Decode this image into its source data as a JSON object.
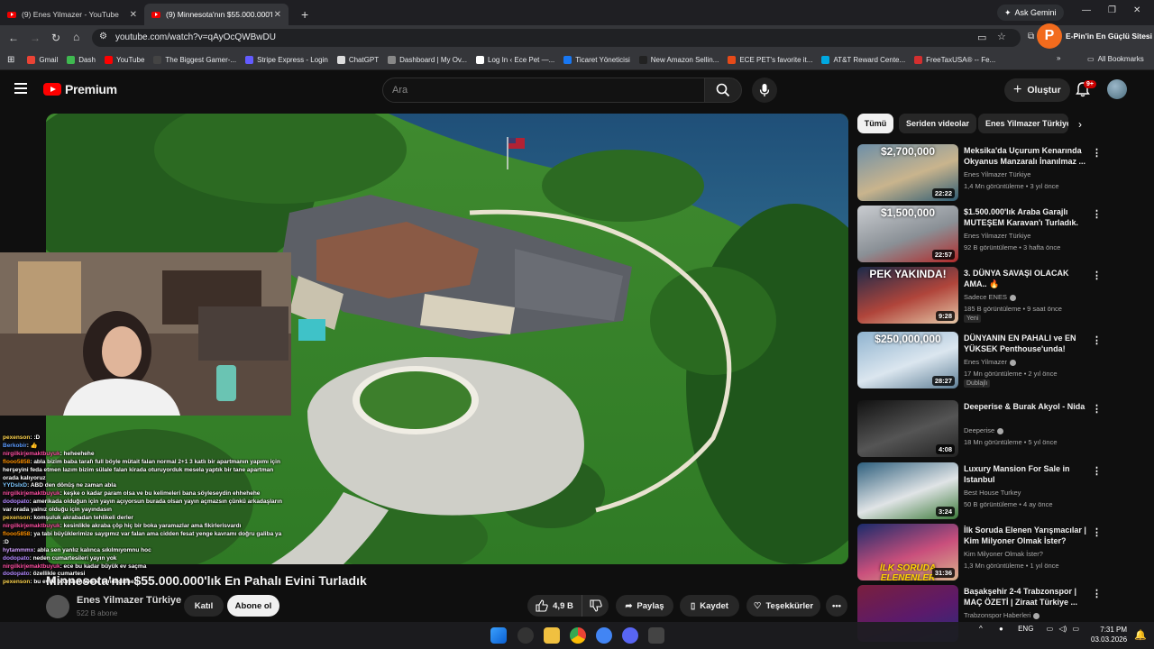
{
  "browser": {
    "tabs": [
      {
        "label": "(9) Enes Yilmazer - YouTube",
        "active": false
      },
      {
        "label": "(9) Minnesota'nın $55.000.000'l",
        "active": true
      }
    ],
    "ask_gemini": "Ask Gemini",
    "url": "youtube.com/watch?v=qAyOcQWBwDU",
    "extension_label": "E-Pin'in En Güçlü Sitesi",
    "extension_letter": "P",
    "bookmarks": [
      {
        "label": "Gmail",
        "color": "#ea4335"
      },
      {
        "label": "Dash",
        "color": "#3fb950"
      },
      {
        "label": "YouTube",
        "color": "#ff0000"
      },
      {
        "label": "The Biggest Gamer-...",
        "color": "#444"
      },
      {
        "label": "Stripe Express - Login",
        "color": "#635bff"
      },
      {
        "label": "ChatGPT",
        "color": "#ddd"
      },
      {
        "label": "Dashboard | My Ov...",
        "color": "#888"
      },
      {
        "label": "Log In ‹ Ece Pet —...",
        "color": "#fff"
      },
      {
        "label": "Ticaret Yöneticisi",
        "color": "#1877f2"
      },
      {
        "label": "New Amazon Sellin...",
        "color": "#222"
      },
      {
        "label": "ECE PET's favorite it...",
        "color": "#e64a19"
      },
      {
        "label": "AT&T Reward Cente...",
        "color": "#00a8e0"
      },
      {
        "label": "FreeTaxUSA® -- Fe...",
        "color": "#d32f2f"
      }
    ],
    "all_bookmarks": "All Bookmarks"
  },
  "header": {
    "logo_text": "Premium",
    "search_placeholder": "Ara",
    "create_label": "Oluştur",
    "notif_count": "9+"
  },
  "video": {
    "title": "Minnesota'nın $55.000.000'lık En Pahalı Evini Turladık",
    "channel": "Enes Yilmazer Türkiye",
    "subscribers": "522 B abone",
    "join_label": "Katıl",
    "subscribe_label": "Abone ol",
    "likes": "4,9 B",
    "share_label": "Paylaş",
    "save_label": "Kaydet",
    "thanks_label": "Teşekkürler"
  },
  "chat": [
    {
      "user": "pexenson",
      "color": "#ffd54f",
      "text": ": :D"
    },
    {
      "user": "Berkobir",
      "color": "#5c9cff",
      "text": ": 👍"
    },
    {
      "user": "nirgilkirjemaktbuyuk",
      "color": "#ff4fa3",
      "text": ": heheehehe"
    },
    {
      "user": "flooo5858",
      "color": "#ff9100",
      "text": ": abla bizim baba tarafı full böyle mütait falan normal 2+1 3 katlı bir apartmanın yapımı için herşeyini feda etmen lazım bizim sülale falan kirada oturuyorduk mesela yaptık bir tane apartman orada kalıyoruz"
    },
    {
      "user": "YYDsIxD",
      "color": "#7ec8ff",
      "text": ": ABD den dönüş ne zaman abla"
    },
    {
      "user": "nirgilkirjemaktbuyuk",
      "color": "#ff4fa3",
      "text": ": keşke o kadar param olsa ve bu kelimeleri bana söyleseydin ehhehehe"
    },
    {
      "user": "dodopato",
      "color": "#b388ff",
      "text": ": amerikada olduğun için yayın açıyorsun burada olsan yayın açmazsın çünkü arkadaşların var orada yalnız olduğu için yayındasın"
    },
    {
      "user": "pexenson",
      "color": "#ffd54f",
      "text": ": komşuluk akrabadan tehlikeli derler"
    },
    {
      "user": "nirgilkirjemaktbuyuk",
      "color": "#ff4fa3",
      "text": ": kesinlikle akraba çöp hiç bir boka yaramazlar ama fikirlerisvardı"
    },
    {
      "user": "flooo5858",
      "color": "#ff9100",
      "text": ": ya tabi büyüklerimize saygımız var falan ama cidden fesat yenge kavramı doğru galiba ya :D"
    },
    {
      "user": "hytammmx",
      "color": "#d1a0ff",
      "text": ": abla sen yanlız kalınca sıkılmıyomnu hoc"
    },
    {
      "user": "dodopato",
      "color": "#b388ff",
      "text": ": neden cumartesileri yayın yok"
    },
    {
      "user": "nirgilkirjemaktbuyuk",
      "color": "#ff4fa3",
      "text": ": ece bu kadar büyük ev saçma"
    },
    {
      "user": "dodopato",
      "color": "#b388ff",
      "text": ": özellikle cumartesi"
    },
    {
      "user": "pexenson",
      "color": "#ffd54f",
      "text": ": bu evde oturan markete kendi gitmez"
    }
  ],
  "chips": [
    {
      "label": "Tümü",
      "active": true
    },
    {
      "label": "Seriden videolar",
      "active": false
    },
    {
      "label": "Enes Yilmazer Türkiye",
      "active": false
    }
  ],
  "recommendations": [
    {
      "title": "Meksika'da Uçurum Kenarında Okyanus Manzaralı İnanılmaz ...",
      "channel": "Enes Yilmazer Türkiye",
      "meta": "1,4 Mn görüntüleme • 3 yıl önce",
      "duration": "22:22",
      "thumb_text": "$2,700,000",
      "colors": [
        "#6d8fa8",
        "#c9b48d",
        "#2f5c73"
      ],
      "verified": false,
      "badge": ""
    },
    {
      "title": "$1.500.000'lık Araba Garajlı MUTEŞEM Karavan'ı Turladık.",
      "channel": "Enes Yilmazer Türkiye",
      "meta": "92 B görüntüleme • 3 hafta önce",
      "duration": "22:57",
      "thumb_text": "$1,500,000",
      "colors": [
        "#c9ccd0",
        "#8a9096",
        "#b22a2a"
      ],
      "verified": false,
      "badge": ""
    },
    {
      "title": "3. DÜNYA SAVAŞI OLACAK AMA.. 🔥",
      "channel": "Sadece ENES",
      "meta": "185 B görüntüleme • 9 saat önce",
      "duration": "9:28",
      "thumb_text": "PEK YAKINDA!",
      "colors": [
        "#1c2a4a",
        "#b0453b",
        "#e5c8a8"
      ],
      "verified": true,
      "badge": "Yeni"
    },
    {
      "title": "DÜNYANIN EN PAHALI ve EN YÜKSEK Penthouse'unda!",
      "channel": "Enes Yilmazer",
      "meta": "17 Mn görüntüleme • 2 yıl önce",
      "duration": "28:27",
      "thumb_text": "$250,000,000",
      "colors": [
        "#8fb3cf",
        "#dbe6ef",
        "#5f7f96"
      ],
      "verified": true,
      "badge": "Dublajlı"
    },
    {
      "title": "Deeperise & Burak Akyol - Nida",
      "channel": "Deeperise",
      "meta": "18 Mn görüntüleme • 5 yıl önce",
      "duration": "4:08",
      "thumb_text": "",
      "colors": [
        "#111",
        "#555",
        "#222"
      ],
      "verified": true,
      "badge": ""
    },
    {
      "title": "Luxury Mansion For Sale in Istanbul",
      "channel": "Best House Turkey",
      "meta": "50 B görüntüleme • 4 ay önce",
      "duration": "3:24",
      "thumb_text": "",
      "colors": [
        "#2e5f7d",
        "#e0e4e6",
        "#3c7a3a"
      ],
      "verified": false,
      "badge": ""
    },
    {
      "title": "İlk Soruda Elenen Yarışmacılar | Kim Milyoner Olmak İster?",
      "channel": "Kim Milyoner Olmak İster?",
      "meta": "1,3 Mn görüntüleme • 1 yıl önce",
      "duration": "31:36",
      "thumb_text": "",
      "overlay": "İLK SORUDA ELENENLER",
      "colors": [
        "#1a2b6b",
        "#c94f7c",
        "#d9b38c"
      ],
      "verified": false,
      "badge": ""
    },
    {
      "title": "Başakşehir 2-4 Trabzonspor | MAÇ ÖZETİ | Ziraat Türkiye ...",
      "channel": "Trabzonspor Haberleri",
      "meta": "",
      "duration": "",
      "thumb_text": "",
      "colors": [
        "#7a1f3d",
        "#5b1a6b",
        "#2c2c7a"
      ],
      "verified": true,
      "badge": ""
    }
  ],
  "taskbar": {
    "lang": "ENG",
    "time": "7:31 PM",
    "date": "03.03.2026"
  }
}
